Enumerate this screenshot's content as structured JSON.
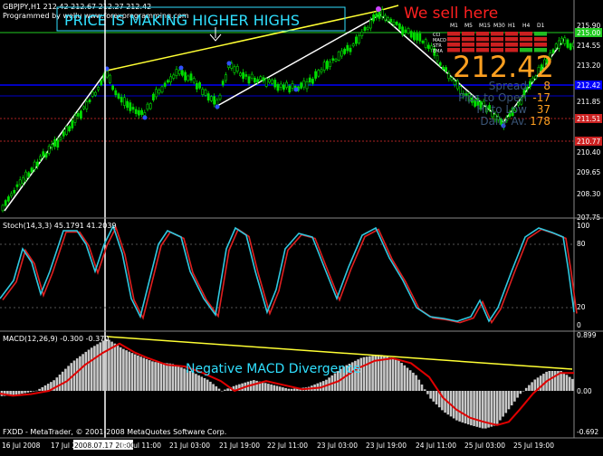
{
  "window": {
    "symbol_header": "GBPJPY,H1  212.42 212.67 212.27 212.42",
    "programmed_by": "Programmed by wellu www.forexprogramming.com",
    "footer": "FXDD - MetaTrader, © 2001-2008 MetaQuotes Software Corp."
  },
  "annotations": {
    "title_text": "PRICE IS MAKING HIGHER HIGHS",
    "sell_text": "We sell here",
    "macd_divergence_text": "Negative MACD Divergence"
  },
  "price_panel": {
    "big_price": "212.42",
    "price_ticks": [
      "215.90",
      "214.55",
      "213.20",
      "211.85",
      "210.40",
      "209.65",
      "208.30",
      "207.75"
    ],
    "line_labels": [
      {
        "text": "215.00",
        "color": "#22cc22"
      },
      {
        "text": "212.42",
        "color": "#0000ff"
      },
      {
        "text": "211.51",
        "color": "#cc2222"
      },
      {
        "text": "210.77",
        "color": "#cc2222"
      }
    ],
    "stats": [
      {
        "label": "Spread",
        "value": "8"
      },
      {
        "label": "Pips to Open",
        "value": "-17"
      },
      {
        "label": "Hi to Low",
        "value": "37"
      },
      {
        "label": "Daily Av.",
        "value": "178"
      }
    ],
    "timeframes": [
      "M1",
      "M5",
      "M15",
      "M30",
      "H1",
      "H4",
      "D1"
    ],
    "side_labels": [
      "CCI",
      "MACD",
      "STR",
      "EMA"
    ]
  },
  "stoch_panel": {
    "header": "Stoch(14,3,3) 45.1791 41.2039",
    "ticks": [
      "100",
      "80",
      "20",
      "0"
    ]
  },
  "macd_panel": {
    "header": "MACD(12,26,9) -0.300 -0.370",
    "ticks": [
      "0.899",
      "0.00",
      "-0.692"
    ]
  },
  "time_axis": {
    "labels": [
      "16 Jul 2008",
      "17 Jul 2008",
      "2008.07.17 20:00",
      "18 Jul 11:00",
      "21 Jul 03:00",
      "21 Jul 19:00",
      "22 Jul 11:00",
      "23 Jul 03:00",
      "23 Jul 19:00",
      "24 Jul 11:00",
      "25 Jul 03:00",
      "25 Jul 19:00"
    ]
  },
  "colors": {
    "candle": "#00dd00",
    "stoch_main": "#30c8e0",
    "stoch_signal": "#e02020",
    "macd_hist": "#c8c8c8",
    "macd_signal": "#e00000",
    "trend_white": "#ffffff",
    "trend_yellow": "#ffff33",
    "annotation_cyan": "#30e0ff",
    "sell_red": "#ff2020",
    "price_orange": "#ffa020"
  }
}
